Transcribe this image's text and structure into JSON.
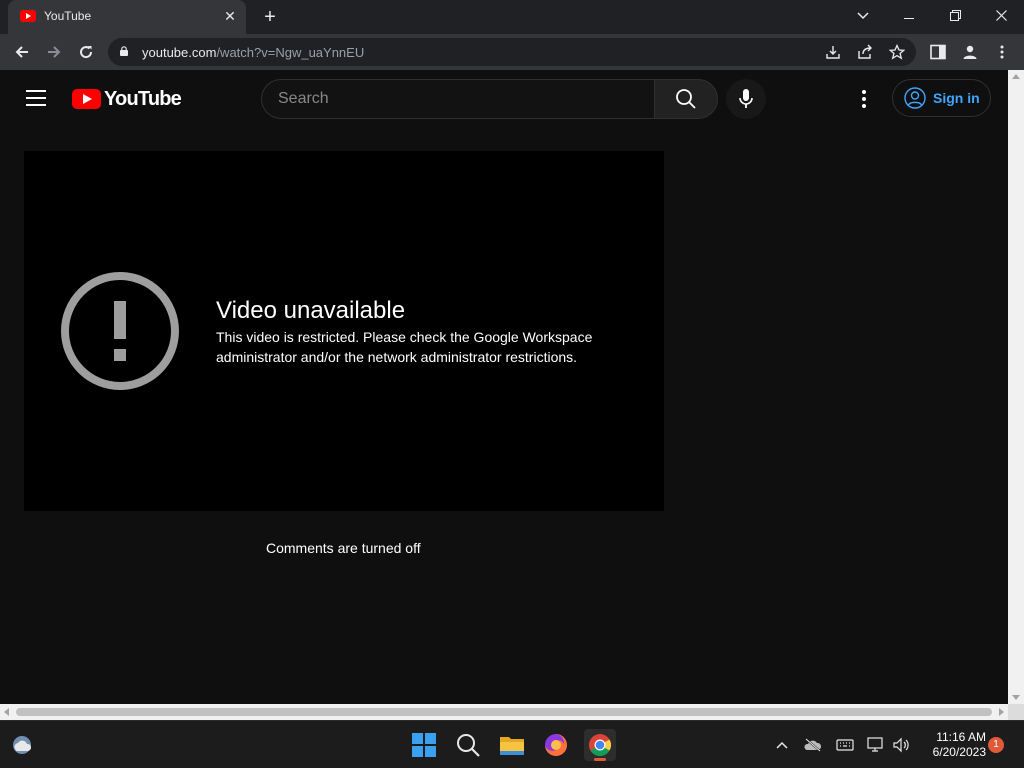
{
  "browser": {
    "tab": {
      "title": "YouTube",
      "close_glyph": "✕"
    },
    "new_tab_glyph": "+",
    "window_controls": {
      "dropdown": "⌵",
      "minimize": "—",
      "restore": "❐",
      "close": "✕"
    },
    "address_bar": {
      "domain": "youtube.com",
      "path": "/watch?v=Ngw_uaYnnEU"
    },
    "nav_glyphs": {
      "back": "←",
      "forward": "→",
      "reload": "↻"
    }
  },
  "youtube": {
    "logo_text": "YouTube",
    "search": {
      "placeholder": "Search"
    },
    "signin_label": "Sign in",
    "player": {
      "error_title": "Video unavailable",
      "error_message": "This video is restricted. Please check the Google Workspace administrator and/or the network administrator restrictions."
    },
    "comments_status": "Comments are turned off"
  },
  "taskbar": {
    "clock": {
      "time": "11:16 AM",
      "date": "6/20/2023"
    },
    "notification_count": "1"
  },
  "colors": {
    "yt_red": "#ff0000",
    "link_blue": "#3ea6ff",
    "page_bg": "#0f0f0f",
    "accent_orange": "#e05a3a"
  }
}
